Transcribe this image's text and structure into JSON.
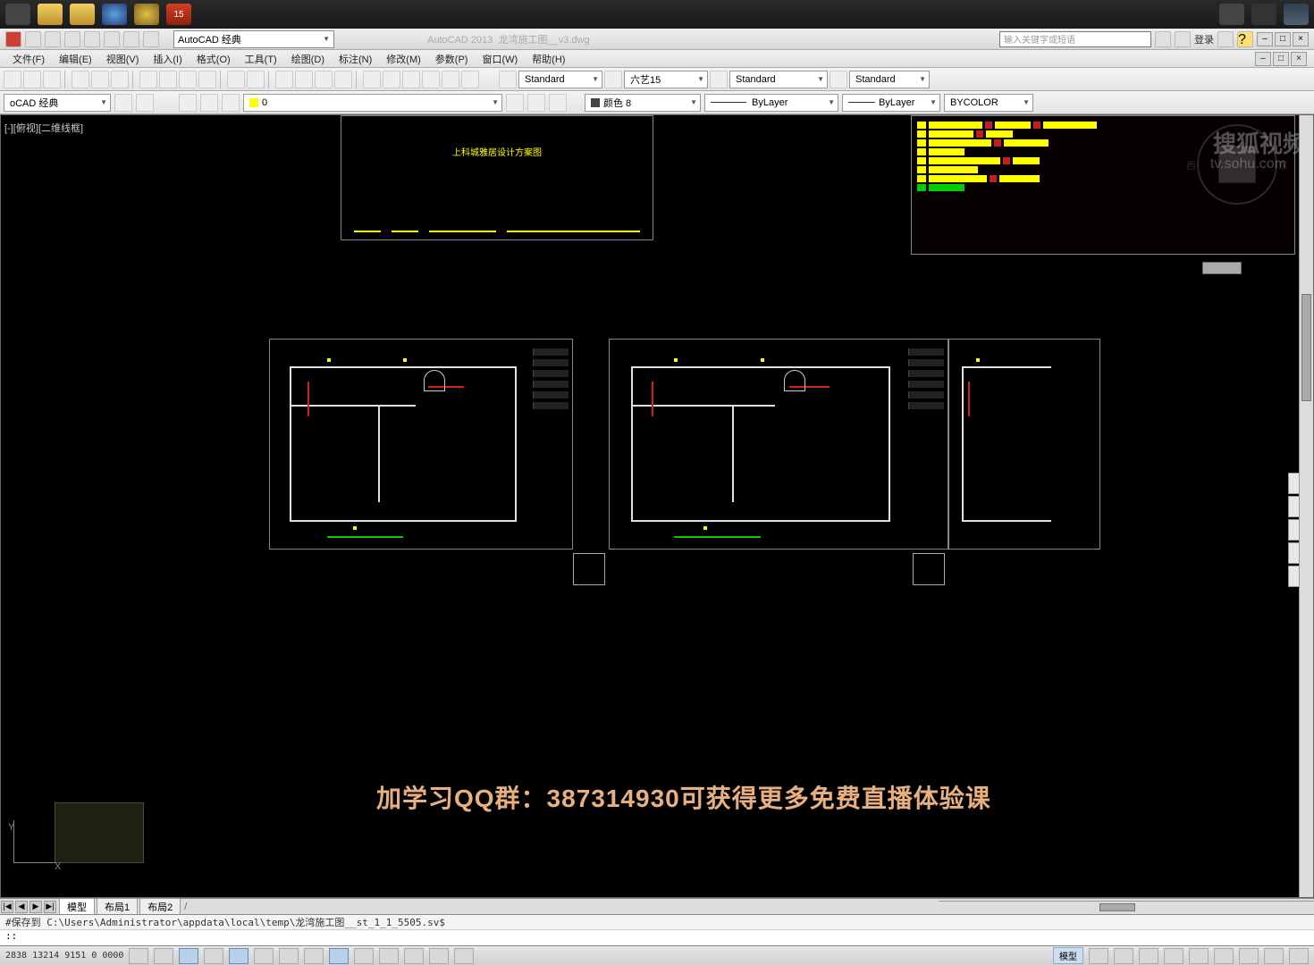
{
  "taskbar": {
    "red_label": "15"
  },
  "title": {
    "app": "AutoCAD 2013",
    "doc": "龙湾施工图__v3.dwg"
  },
  "qat": {
    "workspace": "AutoCAD 经典"
  },
  "search": {
    "placeholder": "输入关键字或短语"
  },
  "login": {
    "label": "登录"
  },
  "menus": {
    "file": "文件(F)",
    "edit": "编辑(E)",
    "view": "视图(V)",
    "insert": "插入(I)",
    "format": "格式(O)",
    "tools": "工具(T)",
    "draw": "绘图(D)",
    "dimension": "标注(N)",
    "modify": "修改(M)",
    "param": "参数(P)",
    "window": "窗口(W)",
    "help": "帮助(H)"
  },
  "styles": {
    "text": "Standard",
    "dim": "六艺15",
    "table": "Standard",
    "mleader": "Standard"
  },
  "layer": {
    "current_ws": "oCAD 经典",
    "layer0": "0"
  },
  "props": {
    "color": "颜色 8",
    "linetype": "ByLayer",
    "lineweight": "ByLayer",
    "plotstyle": "BYCOLOR"
  },
  "view": {
    "label": "[-][俯视][二维线框]"
  },
  "drawing": {
    "title_caption": "上科城雅居设计方案图"
  },
  "overlay": {
    "ad": "加学习QQ群：387314930可获得更多免费直播体验课"
  },
  "watermark": {
    "brand": "搜狐视频",
    "url": "tv.sohu.com"
  },
  "navcube": {
    "w": "西",
    "e": "东"
  },
  "tabs": {
    "model": "模型",
    "layout1": "布局1",
    "layout2": "布局2"
  },
  "cmd": {
    "hist": "#保存到  C:\\Users\\Administrator\\appdata\\local\\temp\\龙湾施工图__st_1_1_5505.sv$",
    "prompt": "::"
  },
  "status": {
    "coords": "2838  13214 9151   0 0000",
    "model": "模型"
  }
}
